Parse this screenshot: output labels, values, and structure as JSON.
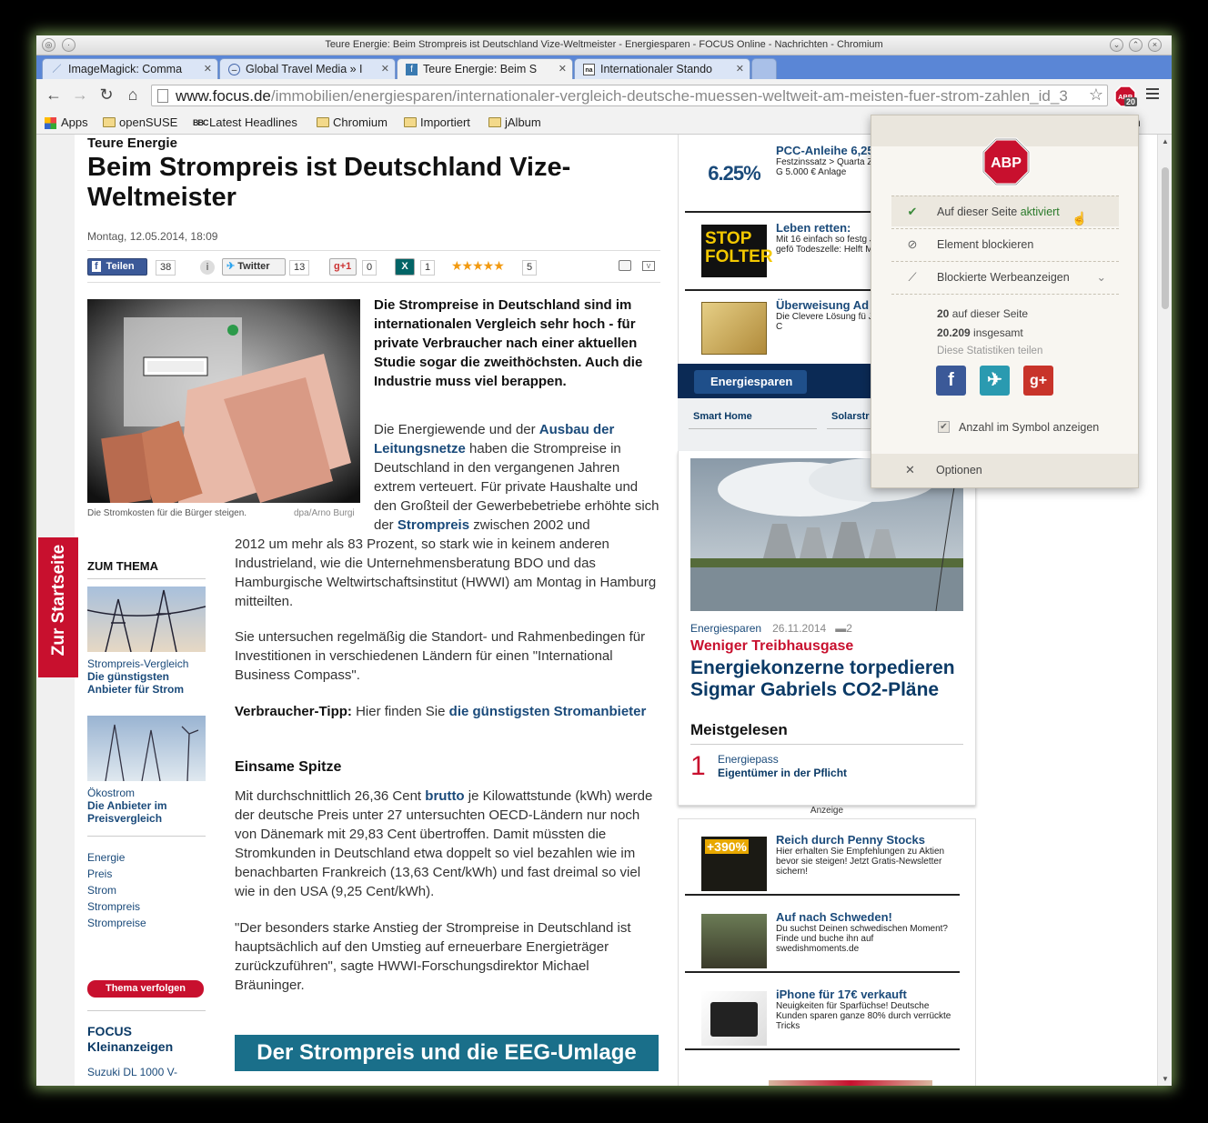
{
  "window": {
    "title": "Teure Energie: Beim Strompreis ist Deutschland Vize-Weltmeister - Energiesparen - FOCUS Online - Nachrichten - Chromium"
  },
  "tabs": [
    {
      "label": "ImageMagick: Comma"
    },
    {
      "label": "Global Travel Media » I"
    },
    {
      "label": "Teure Energie: Beim S"
    },
    {
      "label": "Internationaler Stando"
    }
  ],
  "omnibox": {
    "host": "www.focus.de",
    "path": "/immobilien/energiesparen/internationaler-vergleich-deutsche-muessen-weltweit-am-meisten-fuer-strom-zahlen_id_3"
  },
  "abp_badge": "20",
  "bookmarks": [
    "Apps",
    "openSUSE",
    "Latest Headlines",
    "Chromium",
    "Importiert",
    "jAlbum",
    "hen"
  ],
  "article": {
    "kicker": "Teure Energie",
    "headline": "Beim Strompreis ist Deutschland Vize-Weltmeister",
    "date": "Montag, 12.05.2014, 18:09",
    "share": {
      "fb": "Teilen",
      "fb_count": "38",
      "tw": "Twitter",
      "tw_count": "13",
      "gp": "g+1",
      "gp_count": "0",
      "xing_count": "1",
      "stars": "★★★★★",
      "rating_count": "5"
    },
    "img_caption": "Die Stromkosten für die Bürger steigen.",
    "img_credit": "dpa/Arno Burgi",
    "lead": "Die Strompreise in Deutschland sind im internationalen Vergleich sehr hoch - für private Verbraucher nach einer aktuellen Studie sogar die zweithöchsten. Auch die Industrie muss viel berappen.",
    "p1a": "Die Energiewende und der ",
    "p1link1": "Ausbau der Leitungsnetze",
    "p1b": " haben die Strompreise in Deutschland in den vergangenen Jahren extrem verteuert. Für private Haushalte und den Großteil der Gewerbebetriebe erhöhte sich der ",
    "p1link2": "Strompreis",
    "p1c": " zwischen 2002 und",
    "p1d": "2012 um mehr als 83 Prozent, so stark wie in keinem anderen Industrieland, wie die Unternehmensberatung BDO und das Hamburgische Weltwirtschaftsinstitut (HWWI) am Montag in Hamburg mitteilten.",
    "p2": "Sie untersuchen regelmäßig die Standort- und Rahmenbedingen für Investitionen in verschiedenen Ländern für einen \"International Business Compass\".",
    "tip_label": "Verbraucher-Tipp:",
    "tip_text": " Hier finden Sie ",
    "tip_link": "die günstigsten Stromanbieter",
    "h2": "Einsame Spitze",
    "p3a": "Mit durchschnittlich 26,36 Cent ",
    "p3link": "brutto",
    "p3b": " je Kilowattstunde (kWh) werde der deutsche Preis unter 27 untersuchten OECD-Ländern nur noch von Dänemark mit 29,83 Cent übertroffen. Damit müssten die Stromkunden in Deutschland etwa doppelt so viel bezahlen wie im benachbarten Frankreich (13,63 Cent/kWh) und fast dreimal so viel wie in den USA (9,25 Cent/kWh).",
    "p4": "\"Der besonders starke Anstieg der Strompreise in Deutschland ist hauptsächlich auf den Umstieg auf erneuerbare Energieträger zurückzuführen\", sagte HWWI-Forschungsdirektor Michael Bräuninger.",
    "banner": "Der Strompreis und die EEG-Umlage"
  },
  "sidebar": {
    "zur_startseite": "Zur Startseite",
    "heading": "ZUM THEMA",
    "items": [
      {
        "cat": "Strompreis-Vergleich",
        "title": "Die günstigsten Anbieter für Strom"
      },
      {
        "cat": "Ökostrom",
        "title": "Die Anbieter im Preisvergleich"
      }
    ],
    "tags": [
      "Energie",
      "Preis",
      "Strom",
      "Strompreis",
      "Strompreise"
    ],
    "follow": "Thema verfolgen",
    "klein": "FOCUS Kleinanzeigen",
    "klein_item": "Suzuki DL 1000 V-"
  },
  "right": {
    "ads_top": [
      {
        "title": "PCC-Anleihe 6,25",
        "desc": "Festzinssatz > Quarta Zinszahlung > keine G 5.000 € Anlage",
        "thumb": "6.25%"
      },
      {
        "title": "Leben retten:",
        "desc": "Mit 16 einfach so festg Jahre Gefängnis, gefö Todeszelle: Helft Mose",
        "thumb": "STOP FOLTER"
      },
      {
        "title": "Überweisung Ad",
        "desc": "Die Clevere Lösung fü Jetzt Business Gold C"
      }
    ],
    "section": "Energiesparen",
    "subnav": [
      "Smart Home",
      "Solarstr"
    ],
    "meta_cat": "Energiesparen",
    "meta_date": "26.11.2014",
    "meta_comments": "2",
    "red_kicker": "Weniger Treibhausgase",
    "big_headline": "Energiekonzerne torpedieren Sigmar Gabriels CO2-Pläne",
    "meistgelesen": "Meistgelesen",
    "mg_num": "1",
    "mg_cat": "Energiepass",
    "mg_title": "Eigentümer in der Pflicht",
    "anzeige": "Anzeige",
    "ads_bottom": [
      {
        "title": "Reich durch Penny Stocks",
        "desc": "Hier erhalten Sie Empfehlungen zu Aktien bevor sie steigen! Jetzt Gratis-Newsletter sichern!",
        "thumb": "+390%"
      },
      {
        "title": "Auf nach Schweden!",
        "desc": "Du suchst Deinen schwedischen Moment? Finde und buche ihn auf swedishmoments.de"
      },
      {
        "title": "iPhone für 17€ verkauft",
        "desc": "Neuigkeiten für Sparfüchse! Deutsche Kunden sparen ganze 80% durch verrückte Tricks"
      }
    ]
  },
  "abp_popup": {
    "row1": "Auf dieser Seite ",
    "row1_status": "aktiviert",
    "row2": "Element blockieren",
    "row3": "Blockierte Werbeanzeigen",
    "stat1_num": "20",
    "stat1_txt": " auf dieser Seite",
    "stat2_num": "20.209",
    "stat2_txt": " insgesamt",
    "share": "Diese Statistiken teilen",
    "checkbox": "Anzahl im Symbol anzeigen",
    "options": "Optionen"
  }
}
